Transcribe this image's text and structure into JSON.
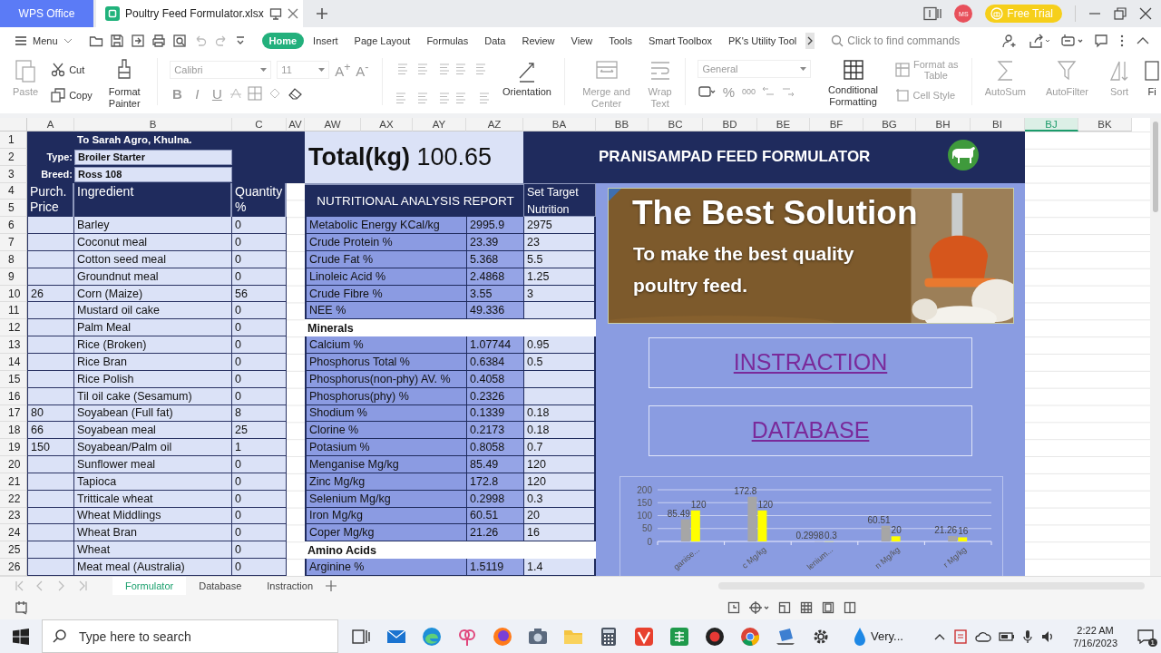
{
  "title_bar": {
    "app_tab": "WPS Office",
    "document_tab": "Poultry Feed Formulator.xlsx",
    "avatar": "MS",
    "trial_button": "Free Trial"
  },
  "menu_bar": {
    "menu_button": "Menu",
    "tabs": [
      {
        "label": "Home",
        "selected": true
      },
      {
        "label": "Insert",
        "selected": false
      },
      {
        "label": "Page Layout",
        "selected": false
      },
      {
        "label": "Formulas",
        "selected": false
      },
      {
        "label": "Data",
        "selected": false
      },
      {
        "label": "Review",
        "selected": false
      },
      {
        "label": "View",
        "selected": false
      },
      {
        "label": "Tools",
        "selected": false
      },
      {
        "label": "Smart Toolbox",
        "selected": false
      },
      {
        "label": "PK's Utility Tool",
        "selected": false
      }
    ],
    "search": {
      "placeholder": "Click to find commands"
    }
  },
  "ribbon": {
    "paste": {
      "label": "Paste",
      "disabled": true
    },
    "cut": {
      "label": "Cut",
      "disabled": false
    },
    "copy": {
      "label": "Copy",
      "disabled": false
    },
    "format_painter": {
      "label": "Format Painter",
      "disabled": false
    },
    "font": {
      "value": "Calibri"
    },
    "font_size": {
      "value": "11"
    },
    "grow_shrink_buttons": [
      "A$^{+}$",
      "A$^{-}$"
    ],
    "font_style_buttons": [
      "B",
      "I",
      "U"
    ],
    "orientation": {
      "label": "Orientation",
      "disabled": false
    },
    "merge": {
      "label": "Merge and Center",
      "disabled": true
    },
    "wrap": {
      "label": "Wrap Text",
      "disabled": true
    },
    "number_format": {
      "value": "General"
    },
    "number_buttons": [
      "%",
      "000"
    ],
    "conditional_formatting": {
      "label": "Conditional Formatting",
      "disabled": false
    },
    "format_as_table": {
      "label": "Format as Table",
      "disabled": true
    },
    "cell_style": {
      "label": "Cell Style",
      "disabled": true
    },
    "autosum": {
      "label": "AutoSum",
      "disabled": true
    },
    "autofilter": {
      "label": "AutoFilter",
      "disabled": true
    },
    "sort": {
      "label": "Sort",
      "disabled": true
    },
    "cut_off_button": {
      "label": "Fi"
    }
  },
  "sheet": {
    "columns": [
      {
        "label": "A",
        "selected": false
      },
      {
        "label": "B",
        "selected": false
      },
      {
        "label": "C",
        "selected": false
      },
      {
        "label": "AV",
        "selected": false
      },
      {
        "label": "AW",
        "selected": false
      },
      {
        "label": "AX",
        "selected": false
      },
      {
        "label": "AY",
        "selected": false
      },
      {
        "label": "AZ",
        "selected": false
      },
      {
        "label": "BA",
        "selected": false
      },
      {
        "label": "BB",
        "selected": false
      },
      {
        "label": "BC",
        "selected": false
      },
      {
        "label": "BD",
        "selected": false
      },
      {
        "label": "BE",
        "selected": false
      },
      {
        "label": "BF",
        "selected": false
      },
      {
        "label": "BG",
        "selected": false
      },
      {
        "label": "BH",
        "selected": false
      },
      {
        "label": "BI",
        "selected": false
      },
      {
        "label": "BJ",
        "selected": true
      },
      {
        "label": "BK",
        "selected": false
      }
    ],
    "row_numbers": [
      "1",
      "2",
      "3",
      "4",
      "5",
      "6",
      "7",
      "8",
      "9",
      "10",
      "11",
      "12",
      "13",
      "14",
      "15",
      "16",
      "17",
      "18",
      "19",
      "20",
      "21",
      "22",
      "23",
      "24",
      "25",
      "26"
    ]
  },
  "formulator": {
    "company": "To Sarah Agro, Khulna.",
    "type_label": "Type:",
    "type": "Broiler Starter",
    "breed_label": "Breed:",
    "breed": "Ross 108",
    "headers": [
      "Purch. Price",
      "Ingredient",
      "Quantity %"
    ],
    "ingredients": [
      {
        "name": "Barley",
        "quantity": "0"
      },
      {
        "name": "Coconut meal",
        "quantity": "0"
      },
      {
        "name": "Cotton seed meal",
        "quantity": "0"
      },
      {
        "name": "Groundnut meal",
        "quantity": "0"
      },
      {
        "price": "26",
        "name": "Corn (Maize)",
        "quantity": "56"
      },
      {
        "name": "Mustard oil cake",
        "quantity": "0"
      },
      {
        "name": "Palm Meal",
        "quantity": "0"
      },
      {
        "name": "Rice (Broken)",
        "quantity": "0"
      },
      {
        "name": "Rice Bran",
        "quantity": "0"
      },
      {
        "name": "Rice Polish",
        "quantity": "0"
      },
      {
        "name": "Til oil cake (Sesamum)",
        "quantity": "0"
      },
      {
        "price": "80",
        "name": "Soyabean (Full fat)",
        "quantity": "8"
      },
      {
        "price": "66",
        "name": "Soyabean meal",
        "quantity": "25"
      },
      {
        "price": "150",
        "name": "Soyabean/Palm oil",
        "quantity": "1"
      },
      {
        "name": "Sunflower meal",
        "quantity": "0"
      },
      {
        "name": "Tapioca",
        "quantity": "0"
      },
      {
        "name": "Tritticale wheat",
        "quantity": "0"
      },
      {
        "name": "Wheat Middlings",
        "quantity": "0"
      },
      {
        "name": "Wheat Bran",
        "quantity": "0"
      },
      {
        "name": "Wheat",
        "quantity": "0"
      },
      {
        "name": "Meat meal (Australia)",
        "quantity": "0"
      }
    ]
  },
  "report": {
    "total": "**Total(kg)** 100.65",
    "title": "NUTRITIONAL ANALYSIS REPORT",
    "target_header": "Set Target Nutrition",
    "rows": [
      {
        "kind": "item",
        "label": "Metabolic Energy KCal/kg",
        "value": "2995.9",
        "target": "2975"
      },
      {
        "kind": "item",
        "label": "Crude Protein %",
        "value": "23.39",
        "target": "23"
      },
      {
        "kind": "item",
        "label": "Crude Fat %",
        "value": "5.368",
        "target": "5.5"
      },
      {
        "kind": "item",
        "label": "Linoleic Acid %",
        "value": "2.4868",
        "target": "1.25"
      },
      {
        "kind": "item",
        "label": "Crude Fibre %",
        "value": "3.55",
        "target": "3"
      },
      {
        "kind": "item",
        "label": "NEE %",
        "value": "49.336"
      },
      {
        "kind": "section",
        "label": "Minerals"
      },
      {
        "kind": "item",
        "label": "Calcium %",
        "value": "1.07744",
        "target": "0.95"
      },
      {
        "kind": "item",
        "label": "Phosphorus Total %",
        "value": "0.6384",
        "target": "0.5"
      },
      {
        "kind": "item",
        "label": "Phosphorus(non-phy) AV. %",
        "value": "0.4058"
      },
      {
        "kind": "item",
        "label": "Phosphorus(phy) %",
        "value": "0.2326"
      },
      {
        "kind": "item",
        "label": "Shodium %",
        "value": "0.1339",
        "target": "0.18"
      },
      {
        "kind": "item",
        "label": "Clorine %",
        "value": "0.2173",
        "target": "0.18"
      },
      {
        "kind": "item",
        "label": "Potasium %",
        "value": "0.8058",
        "target": "0.7"
      },
      {
        "kind": "item",
        "label": "Menganise Mg/kg",
        "value": "85.49",
        "target": "120"
      },
      {
        "kind": "item",
        "label": "Zinc Mg/kg",
        "value": "172.8",
        "target": "120"
      },
      {
        "kind": "item",
        "label": "Selenium Mg/kg",
        "value": "0.2998",
        "target": "0.3"
      },
      {
        "kind": "item",
        "label": "Iron Mg/kg",
        "value": "60.51",
        "target": "20"
      },
      {
        "kind": "item",
        "label": "Coper Mg/kg",
        "value": "21.26",
        "target": "16"
      },
      {
        "kind": "section",
        "label": "Amino Acids"
      },
      {
        "kind": "item",
        "label": "Arginine %",
        "value": "1.5119",
        "target": "1.4"
      }
    ]
  },
  "panel": {
    "title": "PRANISAMPAD FEED FORMULATOR",
    "banner": {
      "kind": "picture",
      "headline": "The Best Solution",
      "tagline": "To make the best quality poultry feed."
    },
    "links": [
      "INSTRACTION",
      "DATABASE"
    ],
    "chart_data": {
      "type": "bar",
      "categories": [
        "ganise...",
        "c Mg/kg",
        "lenium...",
        "n Mg/kg",
        "r Mg/kg"
      ],
      "series": [
        {
          "color": "#a6a6a6",
          "values": [
            85.49,
            172.8,
            0.2998,
            60.51,
            21.26
          ]
        },
        {
          "color": "#ffff00",
          "values": [
            120,
            120,
            0.3,
            20,
            16
          ]
        }
      ],
      "ylim": [
        0,
        200
      ],
      "yticks": [
        0,
        50,
        100,
        150,
        200
      ],
      "grid": true,
      "data_labels": true
    }
  },
  "sheet_tabs": [
    {
      "label": "Formulator",
      "selected": true
    },
    {
      "label": "Database",
      "selected": false
    },
    {
      "label": "Instraction",
      "selected": false
    }
  ],
  "taskbar": {
    "search": {
      "placeholder": "Type here to search"
    },
    "weather": "Very...",
    "time": "2:22 AM",
    "date": "7/16/2023",
    "notifications": "1"
  }
}
